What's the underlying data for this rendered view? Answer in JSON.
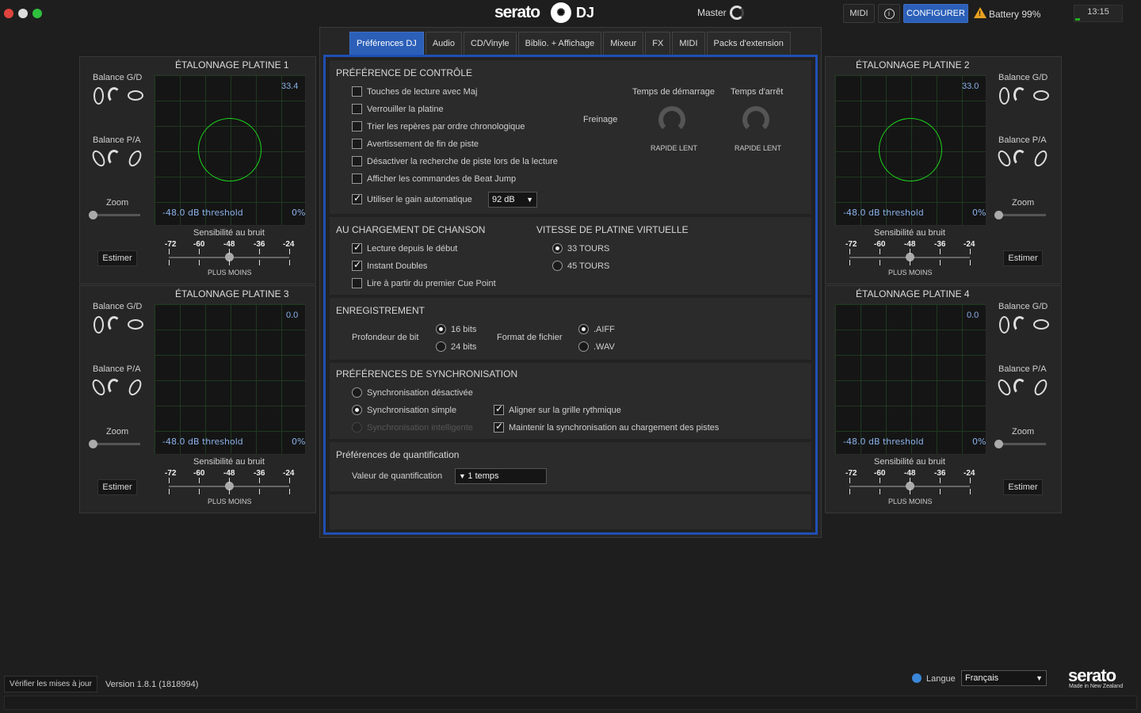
{
  "topbar": {
    "logo_text": "serato",
    "logo_dj": "DJ",
    "master_label": "Master",
    "midi_label": "MIDI",
    "info_label": "i",
    "configure_label": "CONFIGURER",
    "battery_label": "Battery 99%",
    "clock": "13:15",
    "accent": "#2b5fb8"
  },
  "tabs": [
    "Préférences DJ",
    "Audio",
    "CD/Vinyle",
    "Biblio. + Affichage",
    "Mixeur",
    "FX",
    "MIDI",
    "Packs d'extension"
  ],
  "controle": {
    "heading": "PRÉFÉRENCE DE CONTRÔLE",
    "options": [
      {
        "label": "Touches de lecture avec Maj",
        "checked": false
      },
      {
        "label": "Verrouiller la platine",
        "checked": false
      },
      {
        "label": "Trier les repères par ordre chronologique",
        "checked": false
      },
      {
        "label": "Avertissement de fin de piste",
        "checked": false
      },
      {
        "label": "Désactiver la recherche de piste lors de la lecture",
        "checked": false
      },
      {
        "label": "Afficher les commandes de Beat Jump",
        "checked": false
      },
      {
        "label": "Utiliser le gain automatique",
        "checked": true
      }
    ],
    "gain_value": "92 dB",
    "freinage_label": "Freinage",
    "start_label": "Temps de démarrage",
    "stop_label": "Temps d'arrêt",
    "start_range": "RAPIDE LENT",
    "stop_range": "RAPIDE LENT"
  },
  "chargement": {
    "heading": "AU CHARGEMENT DE CHANSON",
    "options": [
      {
        "label": "Lecture depuis le début",
        "checked": true
      },
      {
        "label": "Instant Doubles",
        "checked": true
      },
      {
        "label": "Lire à partir du premier Cue Point",
        "checked": false
      }
    ]
  },
  "vitesse": {
    "heading": "VITESSE DE PLATINE VIRTUELLE",
    "options": [
      {
        "label": "33 TOURS",
        "selected": true
      },
      {
        "label": "45 TOURS",
        "selected": false
      }
    ]
  },
  "enregistrement": {
    "heading": "ENREGISTREMENT",
    "bit_label": "Profondeur de bit",
    "bits": [
      {
        "label": "16 bits",
        "selected": true
      },
      {
        "label": "24 bits",
        "selected": false
      }
    ],
    "format_label": "Format de fichier",
    "formats": [
      {
        "label": ".AIFF",
        "selected": true
      },
      {
        "label": ".WAV",
        "selected": false
      }
    ]
  },
  "sync": {
    "heading": "PRÉFÉRENCES DE SYNCHRONISATION",
    "modes": [
      {
        "label": "Synchronisation désactivée",
        "selected": false,
        "disabled": false
      },
      {
        "label": "Synchronisation simple",
        "selected": true,
        "disabled": false
      },
      {
        "label": "Synchronisation intelligente",
        "selected": false,
        "disabled": true
      }
    ],
    "checks": [
      {
        "label": "Aligner sur la grille rythmique",
        "checked": true
      },
      {
        "label": "Maintenir la synchronisation au chargement des pistes",
        "checked": true
      }
    ]
  },
  "quantif": {
    "heading": "Préférences de quantification",
    "label": "Valeur de quantification",
    "value": "1 temps"
  },
  "platines": [
    {
      "title": "ÉTALONNAGE PLATINE 1",
      "value": "33.4",
      "threshold": "-48.0 dB threshold",
      "pct": "0%",
      "ring": true
    },
    {
      "title": "ÉTALONNAGE PLATINE 2",
      "value": "33.0",
      "threshold": "-48.0 dB threshold",
      "pct": "0%",
      "ring": true
    },
    {
      "title": "ÉTALONNAGE PLATINE 3",
      "value": "0.0",
      "threshold": "-48.0 dB threshold",
      "pct": "0%",
      "ring": false
    },
    {
      "title": "ÉTALONNAGE PLATINE 4",
      "value": "0.0",
      "threshold": "-48.0 dB threshold",
      "pct": "0%",
      "ring": false
    }
  ],
  "panel_labels": {
    "balance_gd": "Balance G/D",
    "balance_pa": "Balance P/A",
    "zoom": "Zoom",
    "estimer": "Estimer",
    "sensibilite": "Sensibilité au bruit",
    "ticks": [
      "-72",
      "-60",
      "-48",
      "-36",
      "-24"
    ],
    "plus_moins": "PLUS MOINS",
    "noise_sensitivity_db": -48
  },
  "footer": {
    "update_btn": "Vérifier les mises à jour",
    "version": "Version 1.8.1 (1818994)",
    "langue_label": "Langue",
    "langue_value": "Français",
    "brand": "serato",
    "brand_sub": "Made in New Zealand"
  }
}
